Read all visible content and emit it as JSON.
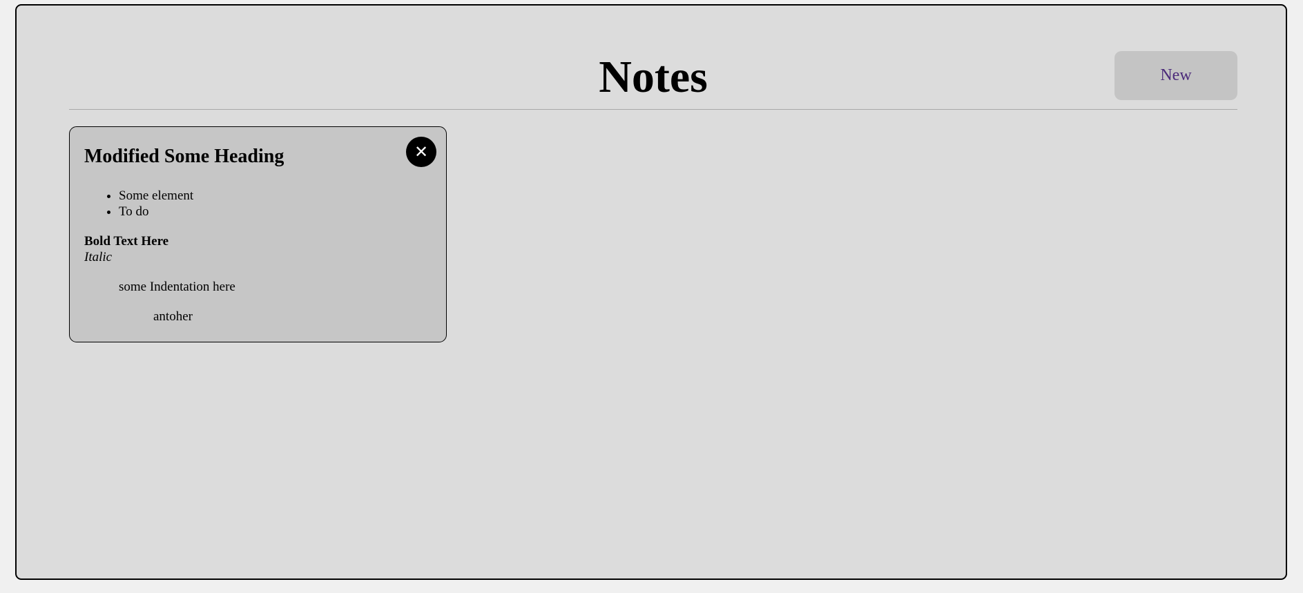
{
  "header": {
    "title": "Notes",
    "new_label": "New"
  },
  "notes": [
    {
      "heading": "Modified Some Heading",
      "close_icon": "✕",
      "list_items": [
        "Some element",
        "To do"
      ],
      "bold_text": "Bold Text Here",
      "italic_text": "Italic",
      "indent_text": "some Indentation here",
      "indent_text_2": "antoher"
    }
  ],
  "colors": {
    "page_background": "#f0f0f0",
    "app_background": "#dcdcdc",
    "card_background": "#c6c6c6",
    "button_background": "#c4c4c4",
    "button_text": "#4b2a7a"
  }
}
